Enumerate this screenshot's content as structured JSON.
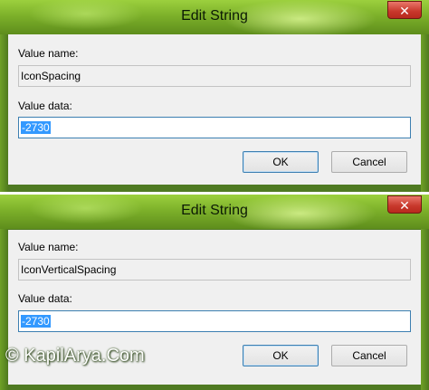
{
  "dialog1": {
    "title": "Edit String",
    "close_glyph": "✕",
    "value_name_label": "Value name:",
    "value_name": "IconSpacing",
    "value_data_label": "Value data:",
    "value_data": "-2730",
    "ok_label": "OK",
    "cancel_label": "Cancel"
  },
  "dialog2": {
    "title": "Edit String",
    "close_glyph": "✕",
    "value_name_label": "Value name:",
    "value_name": "IconVerticalSpacing",
    "value_data_label": "Value data:",
    "value_data": "-2730",
    "ok_label": "OK",
    "cancel_label": "Cancel"
  },
  "watermark": "© KapilArya.Com",
  "colors": {
    "frame_green": "#7db12a",
    "close_red": "#c7372b",
    "selection_blue": "#3399ff"
  }
}
